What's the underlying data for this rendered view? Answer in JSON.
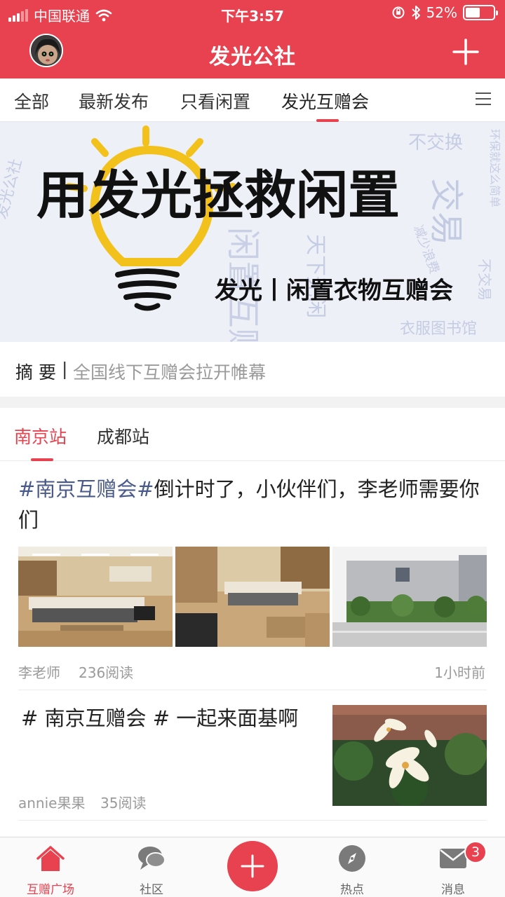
{
  "status_bar": {
    "carrier": "中国联通",
    "time": "下午3:57",
    "battery_percent": "52%",
    "battery_level": 0.52,
    "icons": [
      "signal-icon",
      "wifi-icon",
      "orientation-lock-icon",
      "bluetooth-icon",
      "battery-icon"
    ]
  },
  "nav": {
    "title": "发光公社",
    "avatar_icon": "avatar",
    "add_icon": "plus-icon"
  },
  "tabs": [
    {
      "label": "全部"
    },
    {
      "label": "最新发布"
    },
    {
      "label": "只看闲置"
    },
    {
      "label": "发光互赠会"
    }
  ],
  "active_tab": "发光互赠会",
  "banner": {
    "headline": "用发光拯救闲置",
    "subline": "发光丨闲置衣物互赠会",
    "bg_words": [
      "发光公社",
      "不交换",
      "环保就这么简单",
      "闲置互赠",
      "衣服图书馆",
      "天下无闲",
      "减少浪费",
      "不交易",
      "交易"
    ]
  },
  "summary": {
    "label": "摘 要",
    "separator": "|",
    "text": "全国线下互赠会拉开帷幕"
  },
  "stations": [
    {
      "label": "南京站"
    },
    {
      "label": "成都站"
    }
  ],
  "active_station": "南京站",
  "articles": [
    {
      "hashtag": "#南京互赠会#",
      "title_rest": "倒计时了，小伙伴们，李老师需要你们",
      "author": "李老师",
      "reads": "236阅读",
      "time": "1小时前"
    },
    {
      "title": "# 南京互赠会 # 一起来面基啊",
      "author": "annie果果",
      "reads": "35阅读"
    }
  ],
  "tabbar": [
    {
      "label": "互赠广场",
      "icon": "home-icon"
    },
    {
      "label": "社区",
      "icon": "chat-bubbles-icon"
    },
    {
      "label": "",
      "icon": "plus-icon"
    },
    {
      "label": "热点",
      "icon": "compass-icon"
    },
    {
      "label": "消息",
      "icon": "mail-icon"
    }
  ],
  "message_badge": "3",
  "colors": {
    "brand_red": "#e8414f",
    "hashtag_blue": "#4a5a8a",
    "muted_gray": "#9a9a9a"
  }
}
